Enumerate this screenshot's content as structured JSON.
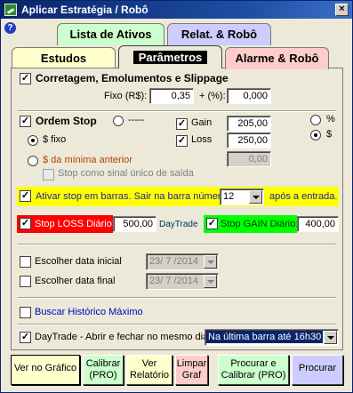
{
  "window": {
    "title": "Aplicar Estratégia / Robô",
    "close": "×"
  },
  "help": "?",
  "tabs": {
    "lista": "Lista de Ativos",
    "relat": "Relat. & Robô",
    "estudos": "Estudos",
    "parametros": "Parâmetros",
    "alarme": "Alarme & Robô"
  },
  "costs": {
    "label": "Corretagem, Emolumentos e Slippage",
    "fixo_label": "Fixo (R$):",
    "fixo_value": "0,35",
    "pct_label": "+ (%):",
    "pct_value": "0,000"
  },
  "stop": {
    "label": "Ordem Stop",
    "radio_dashes": "-----",
    "fixed_label": "$ fixo",
    "min_label": "$ da mínima anterior",
    "signal_label": "Stop como sinal único de saída",
    "gain_label": "Gain",
    "gain_value": "205,00",
    "loss_label": "Loss",
    "loss_value": "250,00",
    "min_value": "0,00",
    "pct_unit": "%",
    "dollar_unit": "$"
  },
  "activate": {
    "label": "Ativar stop em barras. Sair na barra número",
    "bar_value": "12",
    "suffix": "após a entrada."
  },
  "daily": {
    "loss_label": "Stop LOSS Diário:",
    "loss_value": "500,00",
    "daytrade": "DayTrade",
    "gain_label": "Stop GAIN Diário:",
    "gain_value": "400,00"
  },
  "dates": {
    "start_label": "Escolher data inicial",
    "start_value": "23/ 7 /2014",
    "end_label": "Escolher data final",
    "end_value": "23/ 7 /2014"
  },
  "historic_label": "Buscar Histórico Máximo",
  "daytrade_row": {
    "label": "DayTrade - Abrir e fechar no mesmo dia",
    "select_value": "Na última barra até 16h30"
  },
  "buttons": {
    "ver_grafico": "Ver no Gráfico",
    "calibrar": "Calibrar\n(PRO)",
    "ver_relatorio": "Ver\nRelatório",
    "limpar": "Limpar\nGraf",
    "procurar_calibrar": "Procurar e\nCalibrar (PRO)",
    "procurar": "Procurar"
  },
  "colors": {
    "titlebar": "#0a246a",
    "highlight_yellow": "#ffff00",
    "stop_loss_red": "#ff0000",
    "stop_gain_green": "#00ff00",
    "link_blue": "#0000c0"
  }
}
